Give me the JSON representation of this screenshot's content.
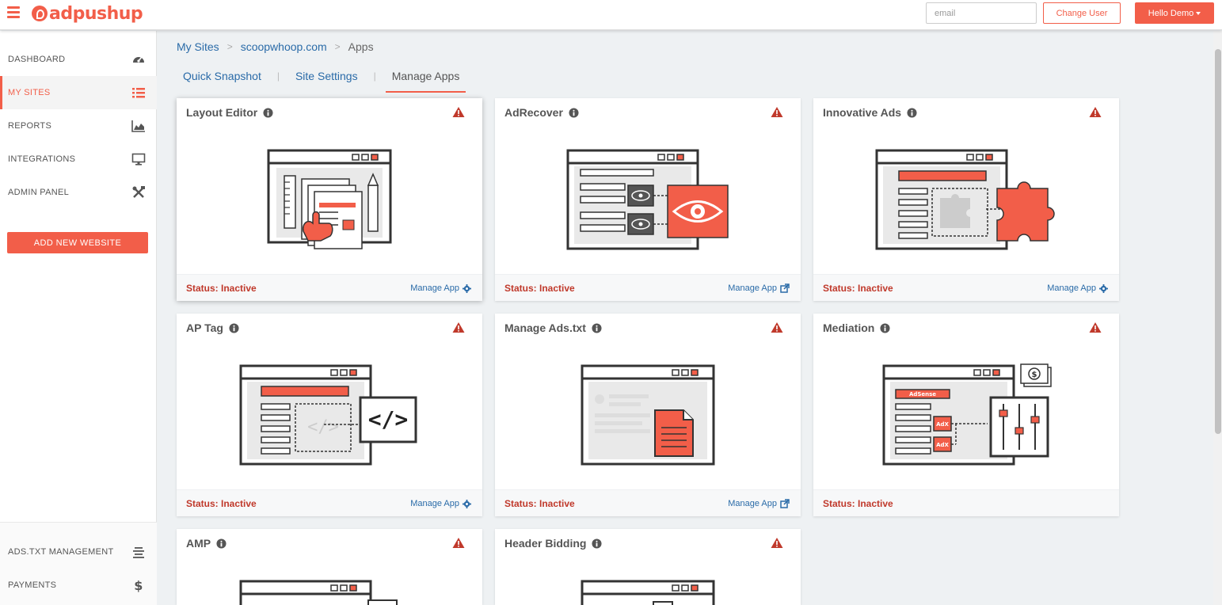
{
  "header": {
    "logo_text": "adpushup",
    "email_placeholder": "email",
    "change_user_label": "Change User",
    "hello_label": "Hello Demo"
  },
  "sidebar": {
    "items": [
      {
        "label": "DASHBOARD",
        "icon": "dashboard-gauge-icon"
      },
      {
        "label": "MY SITES",
        "icon": "list-icon"
      },
      {
        "label": "REPORTS",
        "icon": "area-chart-icon"
      },
      {
        "label": "INTEGRATIONS",
        "icon": "monitor-icon"
      },
      {
        "label": "ADMIN PANEL",
        "icon": "tools-icon"
      }
    ],
    "add_website_label": "ADD NEW WEBSITE",
    "bottom_items": [
      {
        "label": "ADS.TXT MANAGEMENT",
        "icon": "align-center-icon"
      },
      {
        "label": "PAYMENTS",
        "icon": "dollar-icon"
      }
    ]
  },
  "breadcrumb": {
    "root": "My Sites",
    "site": "scoopwhoop.com",
    "current": "Apps",
    "separator": ">"
  },
  "tabs": [
    "Quick Snapshot",
    "Site Settings",
    "Manage Apps"
  ],
  "tab_separator": "|",
  "cards": [
    {
      "title": "Layout Editor",
      "status": "Status: Inactive",
      "manage_label": "Manage App",
      "manage_icon": "gear-icon"
    },
    {
      "title": "AdRecover",
      "status": "Status: Inactive",
      "manage_label": "Manage App",
      "manage_icon": "external-link-icon"
    },
    {
      "title": "Innovative Ads",
      "status": "Status: Inactive",
      "manage_label": "Manage App",
      "manage_icon": "gear-icon"
    },
    {
      "title": "AP Tag",
      "status": "Status: Inactive",
      "manage_label": "Manage App",
      "manage_icon": "gear-icon"
    },
    {
      "title": "Manage Ads.txt",
      "status": "Status: Inactive",
      "manage_label": "Manage App",
      "manage_icon": "external-link-icon"
    },
    {
      "title": "Mediation",
      "status": "Status: Inactive"
    },
    {
      "title": "AMP"
    },
    {
      "title": "Header Bidding"
    }
  ],
  "illustration_labels": {
    "adsense": "AdSense",
    "adx": "AdX"
  },
  "colors": {
    "accent": "#f25e49",
    "link": "#2a6ba8",
    "status_inactive": "#c0392b"
  }
}
